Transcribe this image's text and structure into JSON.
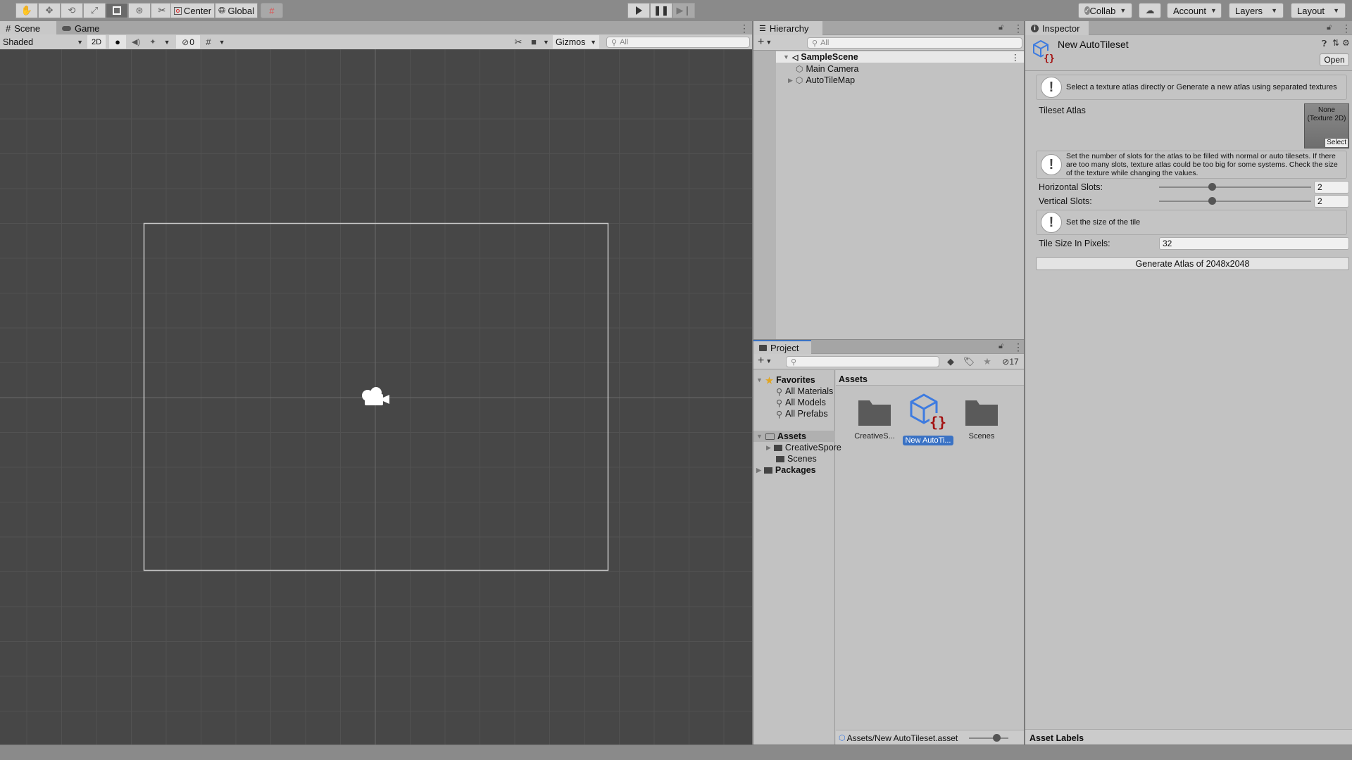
{
  "toolbar": {
    "tools": [
      "hand-tool",
      "move-tool",
      "rotate-tool",
      "scale-tool",
      "rect-tool",
      "transform-tool",
      "custom-tool"
    ],
    "active_tool": "rect-tool",
    "pivot_label": "Center",
    "space_label": "Global",
    "collab_label": "Collab",
    "account_label": "Account",
    "layers_label": "Layers",
    "layout_label": "Layout"
  },
  "scene": {
    "tabs": [
      "Scene",
      "Game"
    ],
    "shading_mode": "Shaded",
    "mode_2d": "2D",
    "hidden_count": "0",
    "gizmos_label": "Gizmos",
    "search_placeholder": "All"
  },
  "hierarchy": {
    "tab_label": "Hierarchy",
    "search_placeholder": "All",
    "scene_name": "SampleScene",
    "items": [
      {
        "label": "Main Camera",
        "expandable": false
      },
      {
        "label": "AutoTileMap",
        "expandable": true
      }
    ]
  },
  "project": {
    "tab_label": "Project",
    "search_value": "",
    "hidden_count": "17",
    "favorites_label": "Favorites",
    "favorites": [
      "All Materials",
      "All Models",
      "All Prefabs"
    ],
    "tree": [
      {
        "label": "Assets",
        "bold": true,
        "children": [
          "CreativeSpore",
          "Scenes"
        ]
      },
      {
        "label": "Packages",
        "bold": true
      }
    ],
    "breadcrumb": "Assets",
    "assets": [
      {
        "label": "CreativeS...",
        "type": "folder",
        "selected": false
      },
      {
        "label": "New AutoTi...",
        "type": "autotileset",
        "selected": true
      },
      {
        "label": "Scenes",
        "type": "folder",
        "selected": false
      }
    ],
    "footer_path": "Assets/New AutoTileset.asset",
    "icon_zoom": 0.75
  },
  "inspector": {
    "tab_label": "Inspector",
    "object_name": "New AutoTileset",
    "open_label": "Open",
    "help1": "Select a texture atlas directly or Generate a new atlas using separated textures",
    "tileset_atlas_label": "Tileset Atlas",
    "atlas_value_line1": "None",
    "atlas_value_line2": "(Texture 2D)",
    "atlas_select_label": "Select",
    "help2": "Set the number of slots for the atlas to be filled with normal or auto tilesets. If there are too many slots, texture atlas could be too big for some systems. Check the size of the texture while changing the values.",
    "horizontal_slots_label": "Horizontal Slots:",
    "horizontal_slots_value": "2",
    "horizontal_slots_fraction": 0.34,
    "vertical_slots_label": "Vertical Slots:",
    "vertical_slots_value": "2",
    "vertical_slots_fraction": 0.34,
    "help3": "Set the size of the tile",
    "tile_size_label": "Tile Size In Pixels:",
    "tile_size_value": "32",
    "generate_label": "Generate Atlas of 2048x2048",
    "asset_labels": "Asset Labels"
  },
  "colors": {
    "selection": "#3a72c4",
    "autotile_blue": "#3d7be0",
    "autotile_red": "#a30f0f",
    "favorite_star": "#e2a521"
  }
}
